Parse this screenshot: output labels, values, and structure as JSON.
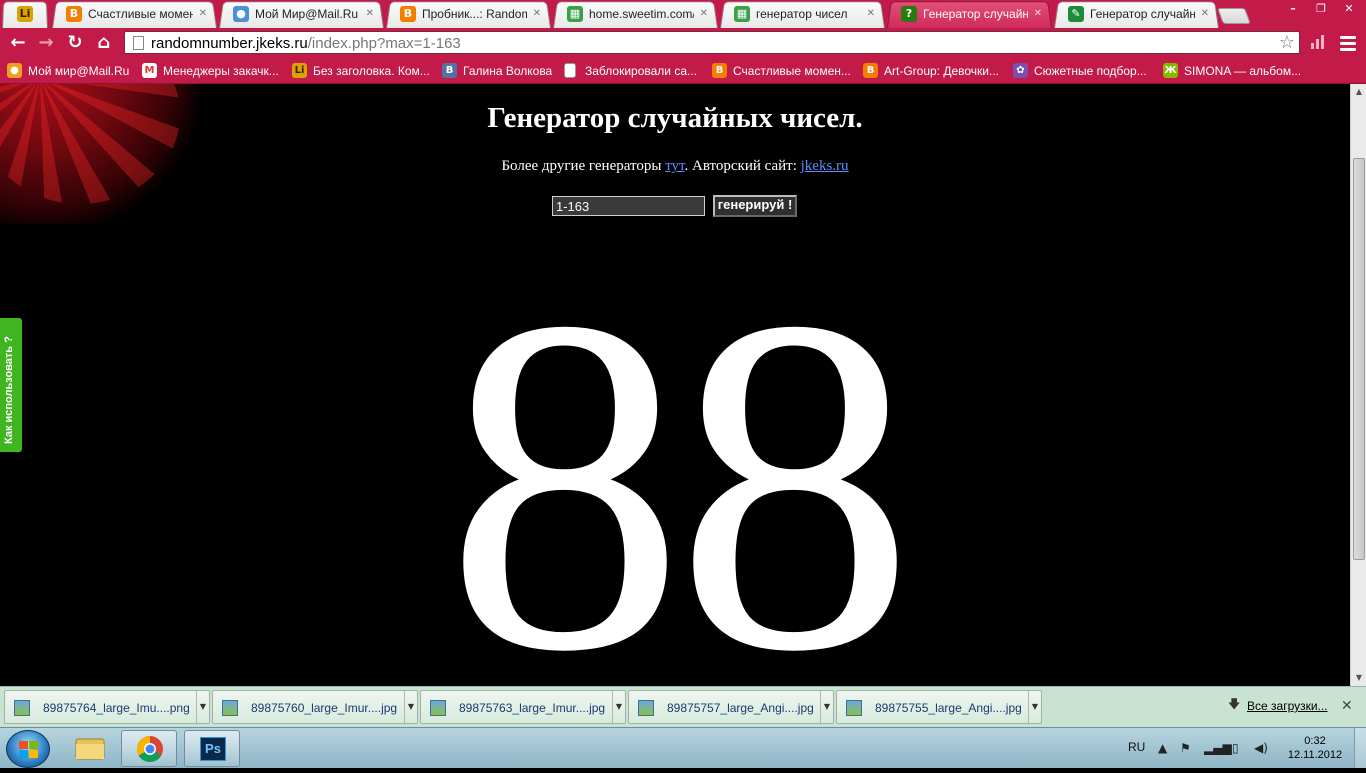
{
  "tabs": [
    {
      "title": "",
      "favicon": "liveinternet-icon",
      "color": "#d9a400",
      "glyph": "Li"
    },
    {
      "title": "Счастливые моменты",
      "favicon": "blogger-icon",
      "color": "#f57d00",
      "glyph": "B"
    },
    {
      "title": "Мой Мир@Mail.Ru",
      "favicon": "mymir-icon",
      "color": "#4a90d9",
      "glyph": "●"
    },
    {
      "title": "Пробник...: Random",
      "favicon": "blogger-icon",
      "color": "#f57d00",
      "glyph": "B"
    },
    {
      "title": "home.sweetim.com/",
      "favicon": "sweetim-icon",
      "color": "#3aa04a",
      "glyph": "▦"
    },
    {
      "title": "генератор чисел",
      "favicon": "sweetim-icon",
      "color": "#3aa04a",
      "glyph": "▦"
    },
    {
      "title": "Генератор случайных чисел",
      "favicon": "question-icon",
      "color": "#3a9a1a",
      "glyph": "?"
    },
    {
      "title": "Генератор случайных",
      "favicon": "green-leaf-icon",
      "color": "#1e8a3a",
      "glyph": "✎"
    }
  ],
  "active_tab_index": 6,
  "toolbar": {
    "url_host": "randomnumber.jkeks.ru",
    "url_path": "/index.php?max=1-163"
  },
  "bookmarks": [
    {
      "label": "Мой мир@Mail.Ru",
      "icon": "mymir-icon",
      "color": "#f0a020",
      "glyph": "●"
    },
    {
      "label": "Менеджеры закачк...",
      "icon": "gmail-icon",
      "color": "#d33",
      "glyph": "M"
    },
    {
      "label": "Без заголовка. Ком...",
      "icon": "liveinternet-icon",
      "color": "#d9a400",
      "glyph": "Li"
    },
    {
      "label": "Галина Волкова",
      "icon": "vk-icon",
      "color": "#5173a1",
      "glyph": "B"
    },
    {
      "label": "Заблокировали са...",
      "icon": "page-icon",
      "color": "#ffffff",
      "glyph": ""
    },
    {
      "label": "Счастливые момен...",
      "icon": "blogger-icon",
      "color": "#f57d00",
      "glyph": "B"
    },
    {
      "label": "Art-Group: Девочки...",
      "icon": "blogger-icon",
      "color": "#f57d00",
      "glyph": "B"
    },
    {
      "label": "Сюжетные подбор...",
      "icon": "flower-icon",
      "color": "#7a4fb0",
      "glyph": "✿"
    },
    {
      "label": "SIMONA — альбом...",
      "icon": "yandex-fotki-icon",
      "color": "#8ab800",
      "glyph": "Ж"
    }
  ],
  "page": {
    "title": "Генератор случайных чисел.",
    "subline_prefix": "Более другие генераторы ",
    "subline_link1": "тут",
    "subline_middle": ". Авторский сайт: ",
    "subline_link2": "jkeks.ru",
    "range_value": "1-163",
    "generate_label": "генерируй !",
    "result": "88",
    "howto_label": "Как использовать ?"
  },
  "downloads": [
    {
      "name": "89875764_large_Imu....png"
    },
    {
      "name": "89875760_large_Imur....jpg"
    },
    {
      "name": "89875763_large_Imur....jpg"
    },
    {
      "name": "89875757_large_Angi....jpg"
    },
    {
      "name": "89875755_large_Angi....jpg"
    }
  ],
  "downloads_all_label": "Все загрузки...",
  "taskbar": {
    "apps": [
      {
        "name": "explorer-icon"
      },
      {
        "name": "chrome-icon"
      },
      {
        "name": "photoshop-icon",
        "label": "Ps"
      }
    ],
    "lang": "RU",
    "time": "0:32",
    "date": "12.11.2012"
  }
}
